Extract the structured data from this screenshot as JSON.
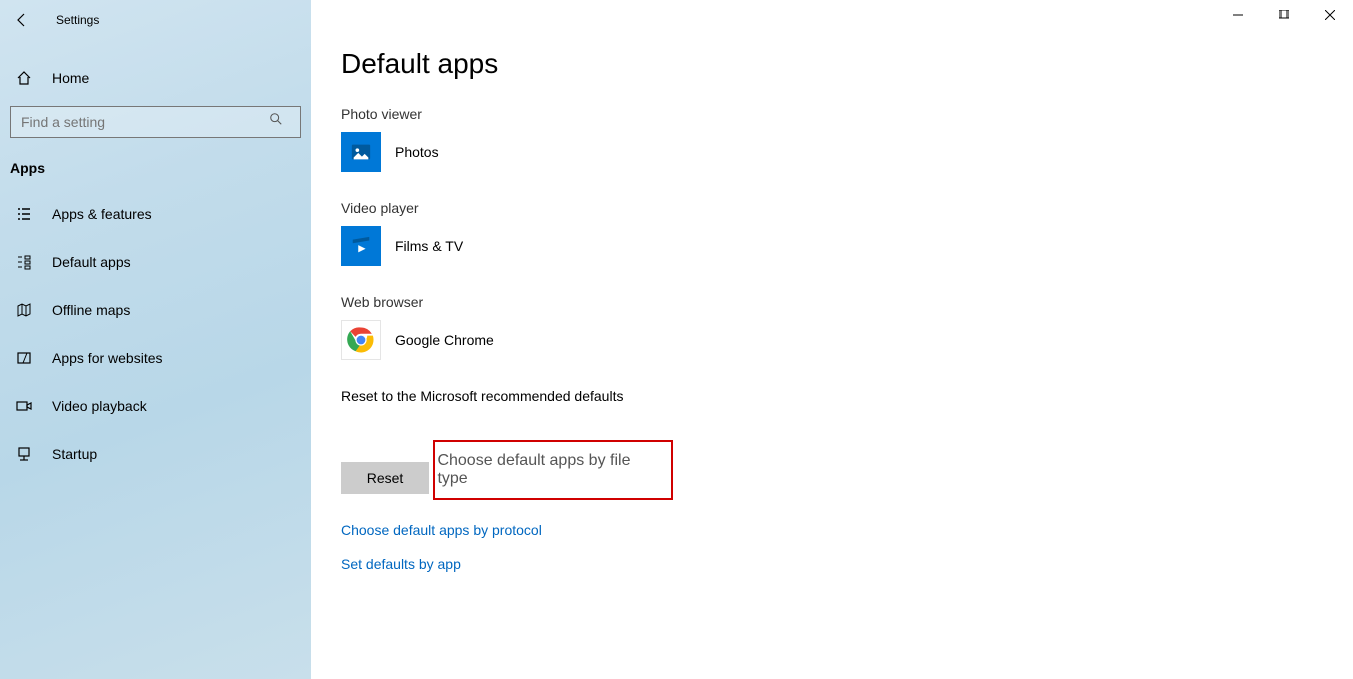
{
  "window": {
    "title": "Settings"
  },
  "sidebar": {
    "home_label": "Home",
    "search_placeholder": "Find a setting",
    "category_header": "Apps",
    "items": [
      {
        "label": "Apps & features"
      },
      {
        "label": "Default apps"
      },
      {
        "label": "Offline maps"
      },
      {
        "label": "Apps for websites"
      },
      {
        "label": "Video playback"
      },
      {
        "label": "Startup"
      }
    ]
  },
  "main": {
    "page_title": "Default apps",
    "sections": {
      "photo_viewer": {
        "label": "Photo viewer",
        "app": "Photos"
      },
      "video_player": {
        "label": "Video player",
        "app": "Films & TV"
      },
      "web_browser": {
        "label": "Web browser",
        "app": "Google Chrome"
      }
    },
    "reset": {
      "label": "Reset to the Microsoft recommended defaults",
      "button": "Reset"
    },
    "links": {
      "by_file_type": "Choose default apps by file type",
      "by_protocol": "Choose default apps by protocol",
      "by_app": "Set defaults by app"
    }
  }
}
